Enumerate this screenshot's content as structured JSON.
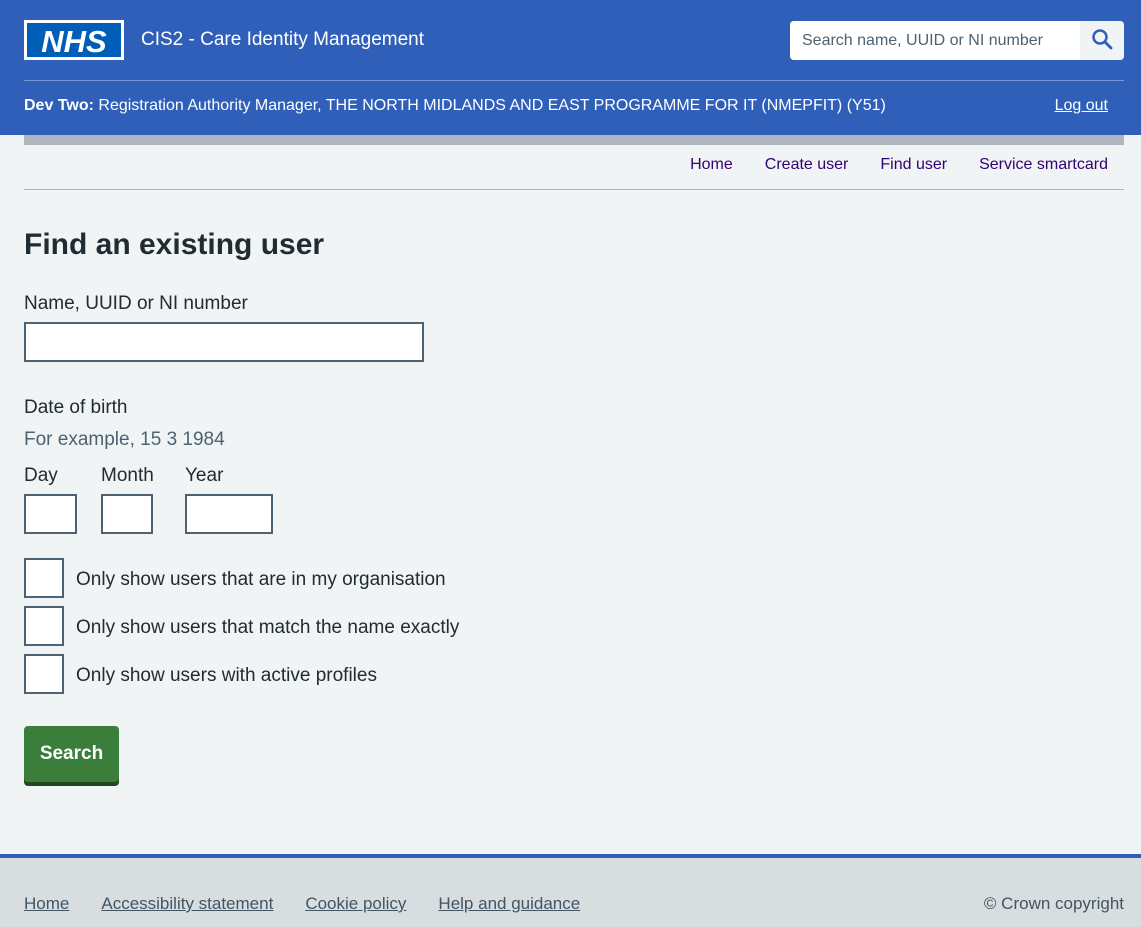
{
  "header": {
    "logo_text": "NHS",
    "service_name": "CIS2 - Care Identity Management",
    "search": {
      "placeholder": "Search name, UUID or NI number",
      "value": "",
      "button_icon": "search-icon"
    },
    "user_name": "Dev Two:",
    "user_role": " Registration Authority Manager, THE NORTH MIDLANDS AND EAST PROGRAMME FOR IT (NMEPFIT) (Y51)",
    "logout_label": "Log out"
  },
  "nav": {
    "items": [
      {
        "label": "Home"
      },
      {
        "label": "Create user"
      },
      {
        "label": "Find user"
      },
      {
        "label": "Service smartcard"
      }
    ]
  },
  "main": {
    "title": "Find an existing user",
    "name_field": {
      "label": "Name, UUID or NI number",
      "value": ""
    },
    "dob": {
      "label": "Date of birth",
      "hint": "For example, 15 3 1984",
      "day_label": "Day",
      "month_label": "Month",
      "year_label": "Year",
      "day_value": "",
      "month_value": "",
      "year_value": ""
    },
    "checkboxes": [
      {
        "label": "Only show users that are in my organisation",
        "checked": false
      },
      {
        "label": "Only show users that match the name exactly",
        "checked": false
      },
      {
        "label": "Only show users with active profiles",
        "checked": false
      }
    ],
    "submit_label": "Search"
  },
  "footer": {
    "links": [
      {
        "label": "Home"
      },
      {
        "label": "Accessibility statement"
      },
      {
        "label": "Cookie policy"
      },
      {
        "label": "Help and guidance"
      }
    ],
    "copyright": "© Crown copyright"
  },
  "colors": {
    "header_bg": "#2f5fb8",
    "nhs_blue": "#005eb8",
    "button_green": "#3b7d3b",
    "nav_link": "#330072",
    "page_bg": "#f0f4f5",
    "footer_bg": "#d8dde0"
  }
}
